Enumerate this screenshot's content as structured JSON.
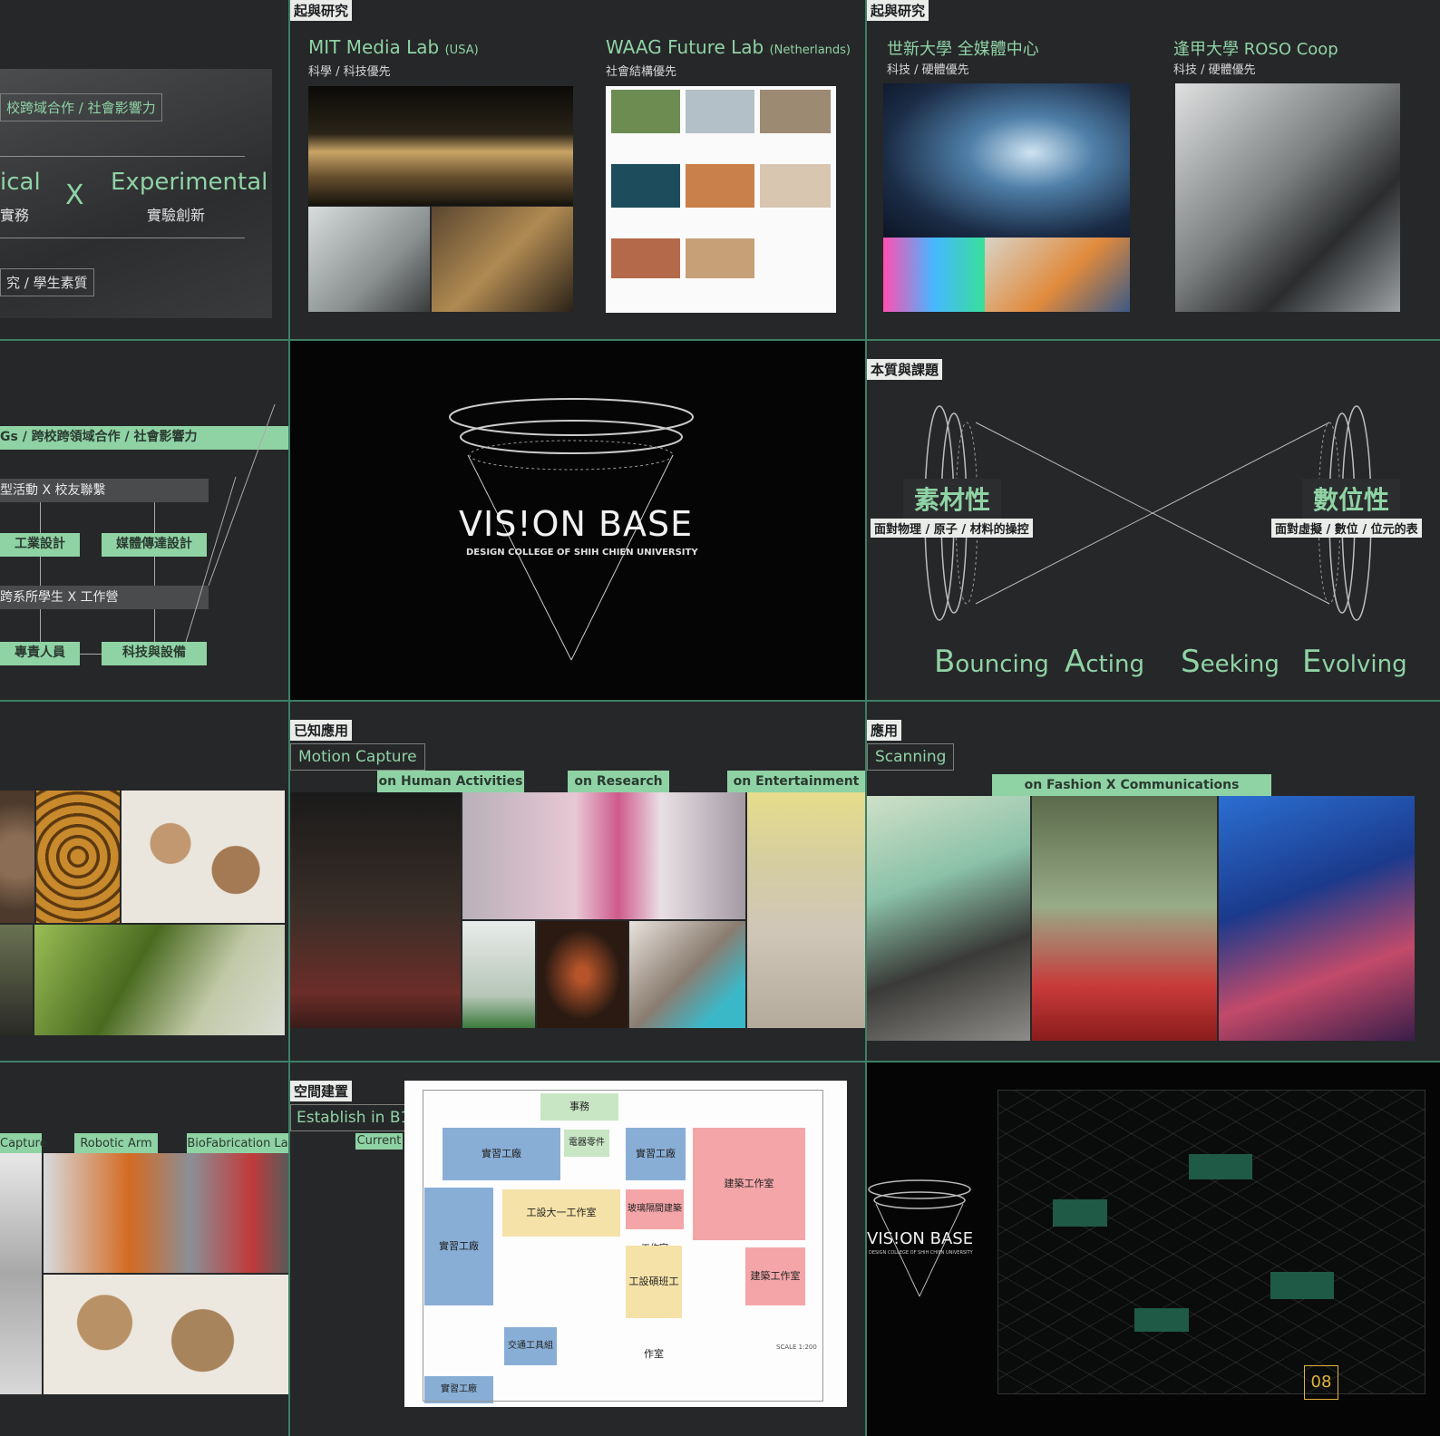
{
  "slide1": {
    "top_box": "校跨域合作 / 社會影響力",
    "left_word": "ical",
    "left_sub": "實務",
    "x_mark": "X",
    "right_word": "Experimental",
    "right_sub": "實驗創新",
    "bottom_box": "究 / 學生素質"
  },
  "slide2": {
    "tag": "起與研究",
    "lab1_title": "MIT Media Lab",
    "lab1_country": "(USA)",
    "lab1_sub": "科學 / 科技優先",
    "lab2_title": "WAAG Future Lab",
    "lab2_country": "(Netherlands)",
    "lab2_sub": "社會結構優先"
  },
  "slide3": {
    "tag": "起與研究",
    "lab1_title": "世新大學 全媒體中心",
    "lab1_sub": "科技 / 硬體優先",
    "lab2_title": "逢甲大學 ROSO Coop",
    "lab2_sub": "科技 / 硬體優先"
  },
  "slide4": {
    "band": "Gs / 跨校跨領域合作 / 社會影響力",
    "bar1": "型活動 X 校友聯繫",
    "pill1": "工業設計",
    "pill2": "媒體傳達設計",
    "bar2": "跨系所學生 X 工作營",
    "pill3": "專責人員",
    "pill4": "科技與設備"
  },
  "slide5": {
    "logo": "VIS!ON BASE",
    "logo_sub": "DESIGN COLLEGE OF SHIH CHIEN UNIVERSITY"
  },
  "slide6": {
    "tag": "本質與課題",
    "left_title": "素材性",
    "left_sub": "面對物理 / 原子 / 材料的操控",
    "right_title": "數位性",
    "right_sub": "面對虛擬 / 數位 / 位元的表",
    "words": [
      {
        "cap": "B",
        "rest": "ouncing"
      },
      {
        "cap": "A",
        "rest": "cting"
      },
      {
        "cap": "S",
        "rest": "eeking"
      },
      {
        "cap": "E",
        "rest": "volving"
      }
    ]
  },
  "slide8": {
    "tag": "已知應用",
    "title": "Motion Capture",
    "pill1": "on Human Activities",
    "pill2": "on Research",
    "pill3": "on Entertainment"
  },
  "slide9": {
    "tag": "應用",
    "title": "Scanning",
    "pill": "on Fashion X Communications"
  },
  "slide10": {
    "pill1": "Capture",
    "pill2": "Robotic Arm",
    "pill3": "BioFabrication La"
  },
  "slide11": {
    "tag": "空間建置",
    "title": "Establish in B1",
    "current": "Current",
    "rooms": {
      "r1": "實習工廠",
      "r2": "事務",
      "r3": "實習工廠",
      "r4": "建築工作室",
      "r5": "工設大一工作室",
      "r6": "玻璃隔間建築工作室",
      "r7": "實習工廠",
      "r8": "工設碩班工作室",
      "r9": "建築工作室",
      "r10": "交通工具組",
      "r11": "實習工廠",
      "r12": "電器零件",
      "r13": "SCALE 1:200"
    }
  },
  "slide12": {
    "logo": "VIS!ON BASE",
    "logo_sub": "DESIGN COLLEGE OF SHIH CHIEN UNIVERSITY",
    "page_number": "08"
  }
}
